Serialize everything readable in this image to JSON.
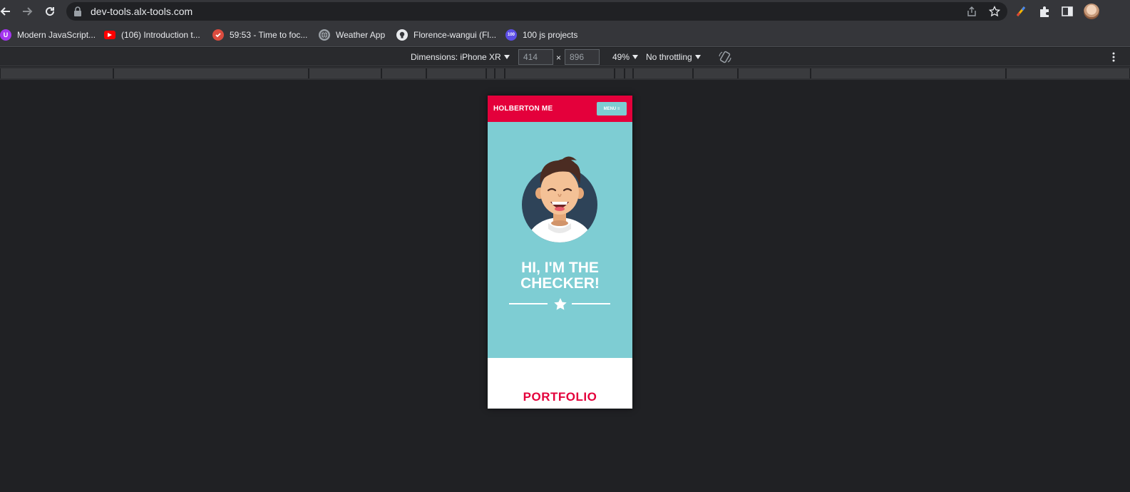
{
  "browser": {
    "url": "dev-tools.alx-tools.com",
    "bookmarks": [
      {
        "label": "Modern JavaScript...",
        "icon": "udemy-icon",
        "color": "#a435f0"
      },
      {
        "label": "(106) Introduction t...",
        "icon": "youtube-icon",
        "color": "#ff0000"
      },
      {
        "label": "59:53 - Time to foc...",
        "icon": "checkmark-icon",
        "color": "#db4c3f"
      },
      {
        "label": "Weather App",
        "icon": "globe-icon",
        "color": "#9aa0a6"
      },
      {
        "label": "Florence-wangui (Fl...",
        "icon": "github-icon",
        "color": "#e8eaed"
      },
      {
        "label": "100 js projects",
        "icon": "badge-icon",
        "color": "#5c4ee5",
        "badge_text": "100"
      }
    ]
  },
  "devtools": {
    "dimensions_label": "Dimensions: iPhone XR",
    "width_value": "414",
    "height_value": "896",
    "times": "×",
    "zoom": "49%",
    "throttling": "No throttling"
  },
  "site": {
    "logo": "HOLBERTON ME",
    "menu_label": "MENU ≡",
    "hero_title": "HI, I'M THE CHECKER!",
    "portfolio_title": "PORTFOLIO",
    "colors": {
      "primary": "#e4003b",
      "hero_bg": "#7ecdd3"
    }
  }
}
